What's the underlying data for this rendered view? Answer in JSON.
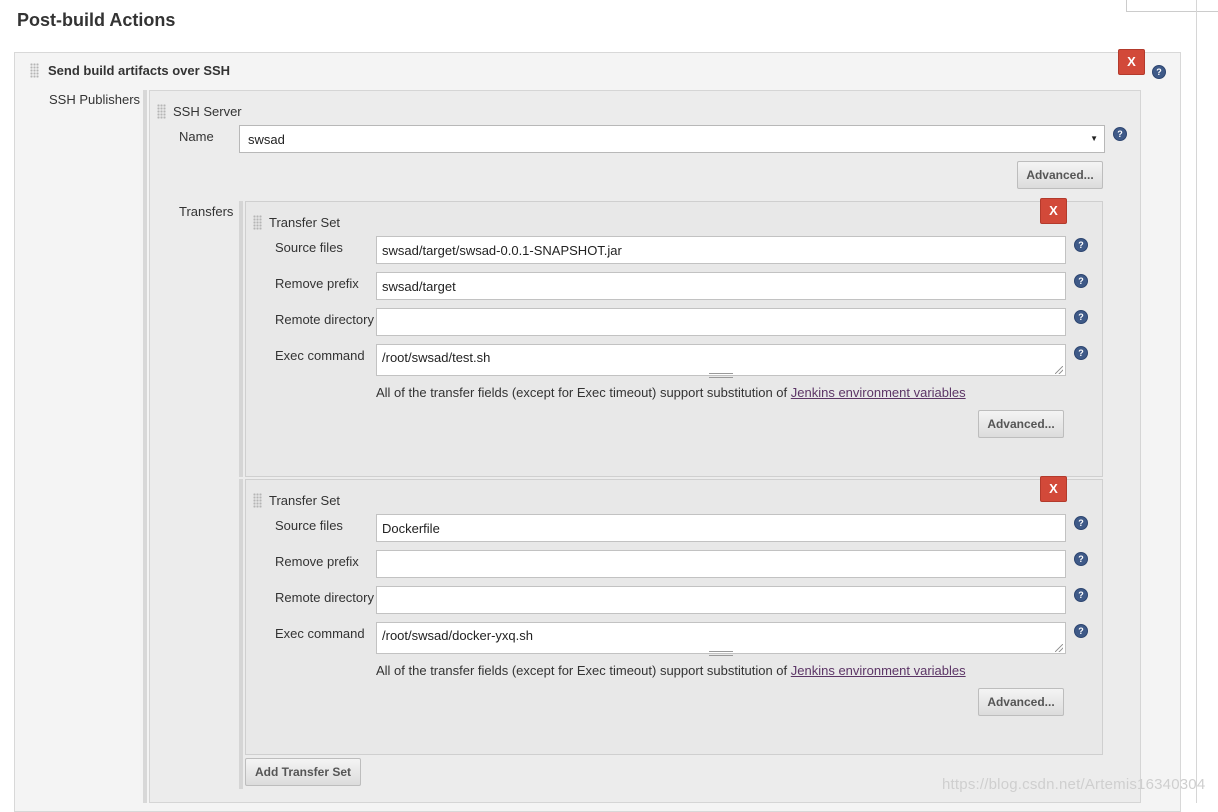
{
  "section": {
    "title": "Post-build Actions"
  },
  "plugin": {
    "title": "Send build artifacts over SSH",
    "delete_label": "X",
    "publishers_label": "SSH Publishers"
  },
  "server": {
    "heading": "SSH Server",
    "name_label": "Name",
    "name_value": "swsad",
    "advanced_label": "Advanced...",
    "transfers_label": "Transfers"
  },
  "transfer_sets": [
    {
      "heading": "Transfer Set",
      "delete_label": "X",
      "source_files_label": "Source files",
      "source_files": "swsad/target/swsad-0.0.1-SNAPSHOT.jar",
      "remove_prefix_label": "Remove prefix",
      "remove_prefix": "swsad/target",
      "remote_directory_label": "Remote directory",
      "remote_directory": "",
      "exec_command_label": "Exec command",
      "exec_command": "/root/swsad/test.sh",
      "note_text": "All of the transfer fields (except for Exec timeout) support substitution of ",
      "note_link": "Jenkins environment variables",
      "advanced_label": "Advanced..."
    },
    {
      "heading": "Transfer Set",
      "delete_label": "X",
      "source_files_label": "Source files",
      "source_files": "Dockerfile",
      "remove_prefix_label": "Remove prefix",
      "remove_prefix": "",
      "remote_directory_label": "Remote directory",
      "remote_directory": "",
      "exec_command_label": "Exec command",
      "exec_command": "/root/swsad/docker-yxq.sh",
      "note_text": "All of the transfer fields (except for Exec timeout) support substitution of ",
      "note_link": "Jenkins environment variables",
      "advanced_label": "Advanced..."
    }
  ],
  "add_transfer_set_label": "Add Transfer Set",
  "help_glyph": "?",
  "watermark": "https://blog.csdn.net/Artemis16340304",
  "colors": {
    "delete": "#d24939",
    "help": "#3f5a88",
    "link": "#5c3566"
  }
}
